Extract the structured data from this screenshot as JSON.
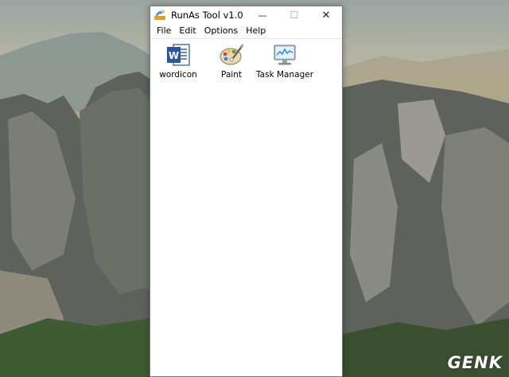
{
  "window": {
    "title": "RunAs Tool v1.0",
    "controls": {
      "minimize": "—",
      "maximize": "☐",
      "close": "✕"
    }
  },
  "menu": {
    "items": [
      {
        "label": "File"
      },
      {
        "label": "Edit"
      },
      {
        "label": "Options"
      },
      {
        "label": "Help"
      }
    ]
  },
  "tiles": [
    {
      "label": "wordicon",
      "icon": "word-icon"
    },
    {
      "label": "Paint",
      "icon": "paint-icon"
    },
    {
      "label": "Task Manager",
      "icon": "task-manager-icon"
    }
  ],
  "watermark": "GENK",
  "colors": {
    "word_blue": "#2b579a",
    "window_bg": "#ffffff"
  }
}
